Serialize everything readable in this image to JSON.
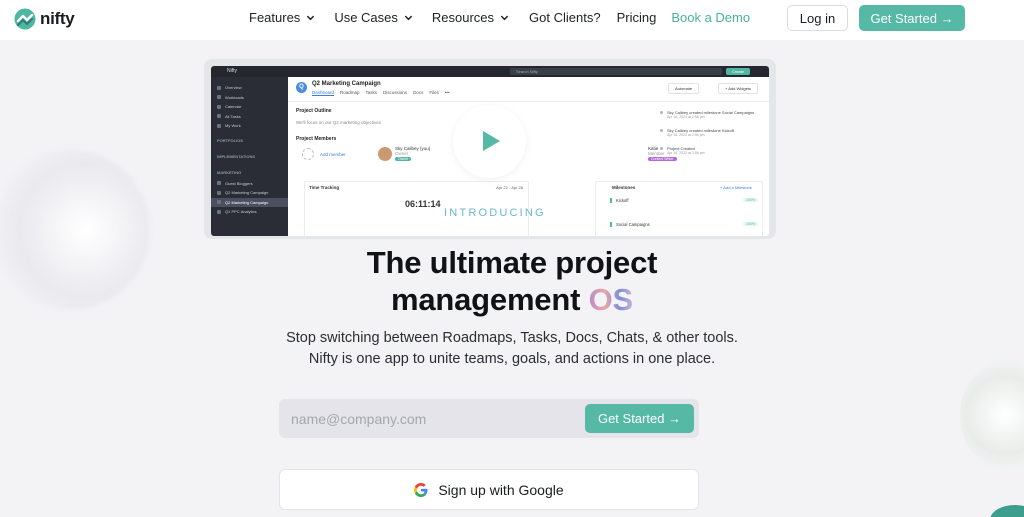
{
  "header": {
    "logo_text": "nifty",
    "nav": [
      {
        "label": "Features",
        "dropdown": true
      },
      {
        "label": "Use Cases",
        "dropdown": true
      },
      {
        "label": "Resources",
        "dropdown": true
      },
      {
        "label": "Got Clients?",
        "dropdown": false
      },
      {
        "label": "Pricing",
        "dropdown": false
      },
      {
        "label": "Book a Demo",
        "dropdown": false
      }
    ],
    "login_label": "Log in",
    "get_started_label": "Get Started →"
  },
  "app_preview": {
    "topbar": {
      "brand": "Nifty",
      "search": "Search Nifty",
      "create": "Create"
    },
    "sidebar": {
      "items": [
        "Overview",
        "Workloads",
        "Calendar",
        "All Tasks",
        "My Work"
      ],
      "sections": [
        "PORTFOLIOS",
        "IMPLEMENTATIONS",
        "MARKETING"
      ],
      "projects": [
        "Guest Bloggers",
        "Q2 Marketing Campaign",
        "Q2 Marketing Campaign",
        "Q1 PPC Analytics"
      ]
    },
    "project": {
      "icon_letter": "Q",
      "title": "Q2 Marketing Campaign",
      "tabs": [
        "Dashboard",
        "Roadmap",
        "Tasks",
        "Discussions",
        "Docs",
        "Files",
        "•••"
      ],
      "automate": "Automate",
      "add_widgets": "+ Add Widgets",
      "outline_heading": "Project Outline",
      "outline_text": "We'll focus on our Q2 marketing objectives",
      "members_heading": "Project Members",
      "add_member": "Add member",
      "members": [
        {
          "name": "Sky Calibey (you)",
          "role": "Owner",
          "tag": "Owner"
        },
        {
          "name": "Katie",
          "role": "Member",
          "tag": "Content Writer"
        }
      ],
      "activity": [
        {
          "text": "Sky Calibey created milestone Social Campaigns",
          "time": "Apr 16, 2022 at 2:56 pm"
        },
        {
          "text": "Sky Calibey created milestone Kickoff",
          "time": "Apr 16, 2022 at 2:56 pm"
        },
        {
          "text": "Project Created",
          "time": "Apr 16, 2022 at 2:56 pm"
        }
      ],
      "time_tracking": {
        "heading": "Time Tracking",
        "range": "Apr 22 - Apr 28",
        "total": "06:11:14"
      },
      "milestones": {
        "heading": "Milestones",
        "add": "+ Add a Milestone",
        "rows": [
          {
            "name": "Kickoff",
            "pct": "100%"
          },
          {
            "name": "Social Campaigns",
            "pct": "100%"
          }
        ]
      }
    },
    "introducing": "INTRODUCING"
  },
  "hero": {
    "line1": "The ultimate project",
    "line2_prefix": "management ",
    "line2_os": "OS",
    "sub1": "Stop switching between Roadmaps, Tasks, Docs, Chats, & other tools.",
    "sub2": "Nifty is one app to unite teams, goals, and actions in one place."
  },
  "signup": {
    "email_placeholder": "name@company.com",
    "email_value": "",
    "submit_label": "Get Started →",
    "google_label": "Sign up with Google"
  },
  "colors": {
    "brand_teal": "#55b9a6",
    "demo_link": "#49b2a0"
  }
}
